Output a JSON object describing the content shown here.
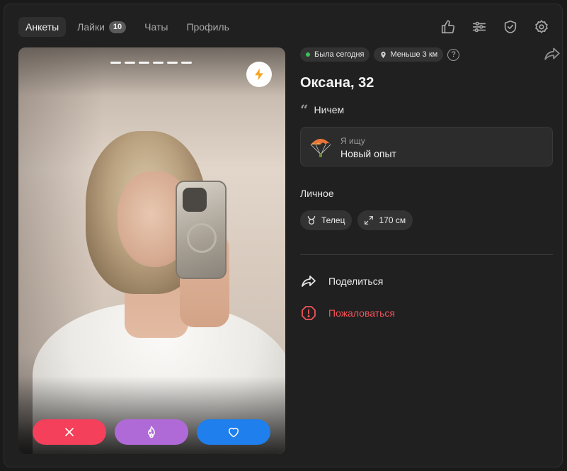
{
  "nav": {
    "tabs": [
      {
        "label": "Анкеты",
        "active": true
      },
      {
        "label": "Лайки",
        "badge": "10"
      },
      {
        "label": "Чаты"
      },
      {
        "label": "Профиль"
      }
    ],
    "icons": [
      "thumbs-up-icon",
      "sliders-icon",
      "shield-check-icon",
      "gear-icon"
    ]
  },
  "photo": {
    "photo_count": 6,
    "actions": [
      "close-icon",
      "flame-icon",
      "heart-icon"
    ],
    "colors": {
      "dislike": "#f4405a",
      "super": "#b06ad8",
      "like": "#1f7fec"
    }
  },
  "profile": {
    "status": "Была сегодня",
    "distance": "Меньше 3 км",
    "help": "?",
    "name_age": "Оксана, 32",
    "quote": "Ничем",
    "goal_label": "Я ищу",
    "goal_value": "Новый опыт",
    "section_title": "Личное",
    "chips": [
      {
        "icon": "taurus-icon",
        "label": "Телец"
      },
      {
        "icon": "height-icon",
        "label": "170 см"
      }
    ],
    "share_label": "Поделиться",
    "report_label": "Пожаловаться"
  }
}
